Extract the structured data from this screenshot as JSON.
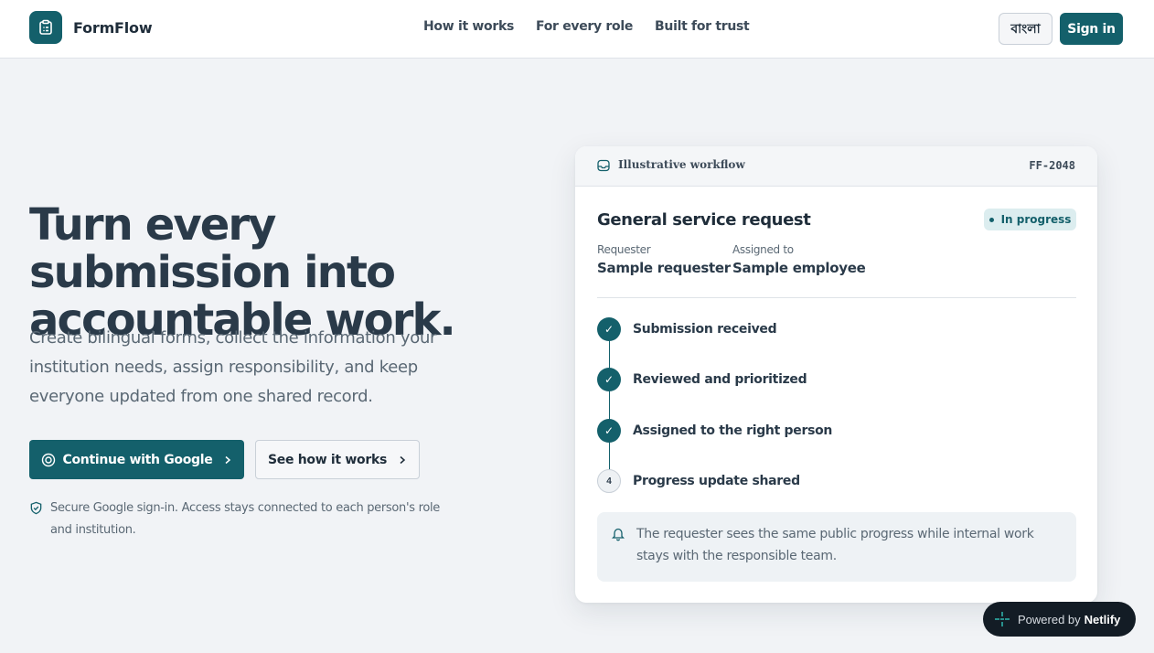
{
  "brand": {
    "name": "FormFlow",
    "logo_icon": "form-clipboard-icon",
    "accent": "#14606b"
  },
  "nav": [
    {
      "label": "How it works"
    },
    {
      "label": "For every role"
    },
    {
      "label": "Built for trust"
    }
  ],
  "header": {
    "language_label": "বাংলা",
    "signin_label": "Sign in"
  },
  "hero": {
    "title": "Turn every submission into accountable work.",
    "description": "Create bilingual forms, collect the information your institution needs, assign responsibility, and keep everyone updated from one shared record.",
    "primary_cta": "Continue with Google",
    "secondary_cta": "See how it works",
    "secure_note": "Secure Google sign-in. Access stays connected to each person's role and institution."
  },
  "card": {
    "header_label": "Illustrative workflow",
    "request_id": "FF-2048",
    "title": "General service request",
    "status": "In progress",
    "requester_label": "Requester",
    "requester_value": "Sample requester",
    "assigned_label": "Assigned to",
    "assigned_value": "Sample employee",
    "steps": [
      {
        "label": "Submission received",
        "state": "done",
        "marker": "✓"
      },
      {
        "label": "Reviewed and prioritized",
        "state": "done",
        "marker": "✓"
      },
      {
        "label": "Assigned to the right person",
        "state": "done",
        "marker": "✓"
      },
      {
        "label": "Progress update shared",
        "state": "pending",
        "marker": "4"
      }
    ],
    "note": "The requester sees the same public progress while internal work stays with the responsible team."
  },
  "badge_netlify": {
    "prefix": "Powered by",
    "brand": "Netlify"
  }
}
